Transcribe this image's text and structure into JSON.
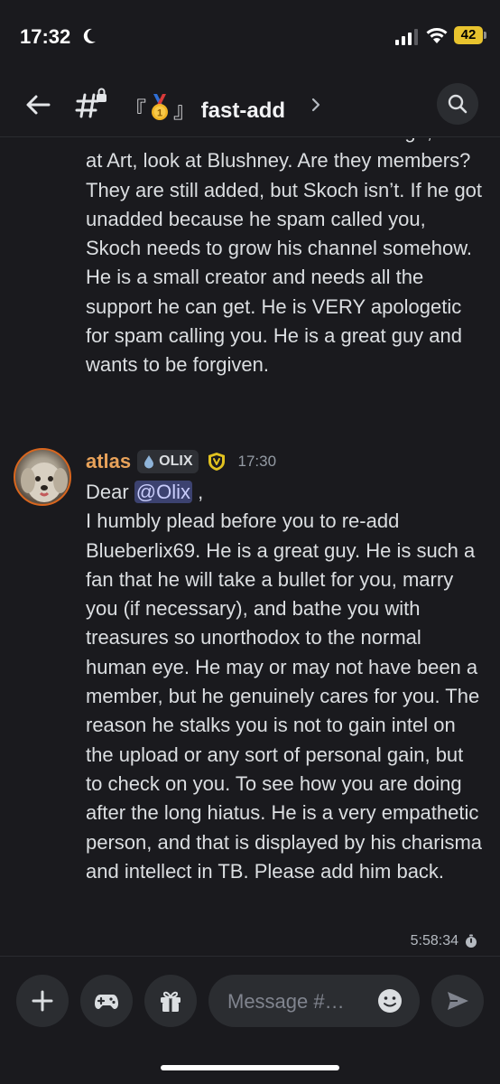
{
  "status_bar": {
    "time": "17:32",
    "battery": "42"
  },
  "header": {
    "channel_name": "fast-add",
    "bracket_open": "『",
    "bracket_close": "』"
  },
  "messages": [
    {
      "text": "a member for a while. Look at Drallage, look at Art, look at Blushney. Are they members? They are still added, but Skoch isn’t. If he got unadded because he spam called you, Skoch needs to grow his channel somehow. He is a small creator and needs all the support he can get. He is VERY apologetic for spam calling you. He is a great guy and wants to be forgiven."
    },
    {
      "author": "atlas",
      "clan_tag": "OLIX",
      "timestamp": "17:30",
      "greeting": "Dear ",
      "mention": "@Olix",
      "greeting_suffix": " ,",
      "body": "I humbly plead before you to re-add Blueberlix69. He is a great guy. He is such a fan that he will take a bullet for you, marry you (if necessary), and bathe you with treasures so unorthodox to the normal human eye. He may or may not have been a member, but he genuinely cares for you. The reason he stalks you is not to gain intel on the upload or any sort of personal gain, but to check on you. To see how you are doing after the long hiatus. He is a very empathetic person, and that is displayed by his charisma and intellect in TB. Please add him back."
    }
  ],
  "slowmode_timer": "5:58:34",
  "composer": {
    "placeholder": "Message #…"
  },
  "colors": {
    "background": "#1a1a1e",
    "author": "#e8a25a",
    "mention_bg": "#3c4270",
    "battery": "#e8c32e"
  },
  "icons": [
    "moon-icon",
    "signal-icon",
    "wifi-icon",
    "back-arrow-icon",
    "channel-hash-lock-icon",
    "medal-icon",
    "chevron-right-icon",
    "search-icon",
    "water-drop-icon",
    "shield-badge-icon",
    "timer-icon",
    "plus-icon",
    "gamepad-icon",
    "gift-icon",
    "emoji-icon",
    "send-icon"
  ]
}
